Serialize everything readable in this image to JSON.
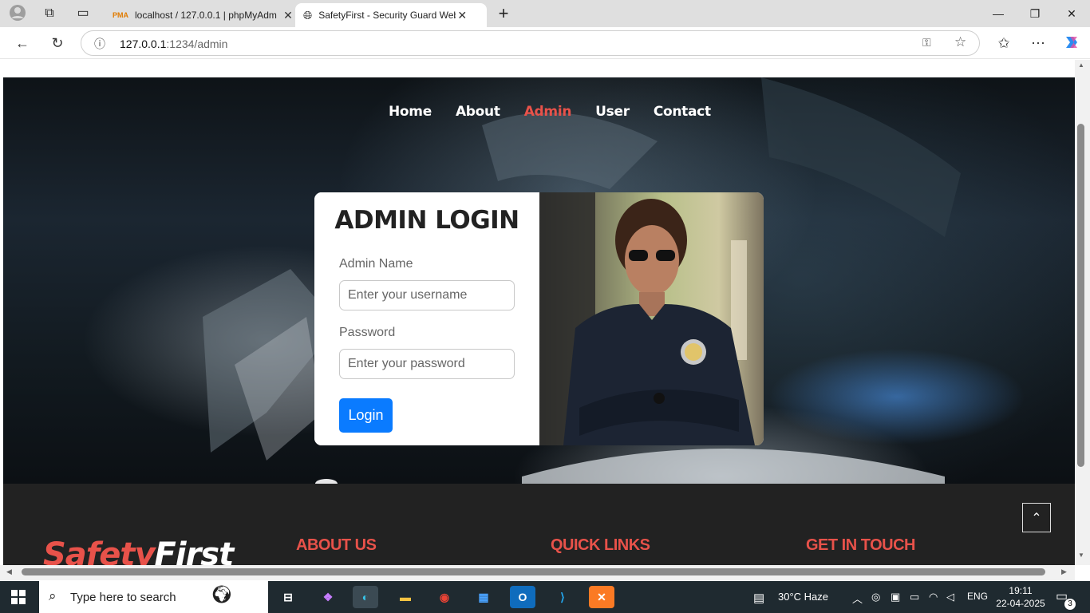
{
  "browser": {
    "tabs": [
      {
        "title": "localhost / 127.0.0.1 | phpMyAdm"
      },
      {
        "title": "SafetyFirst - Security Guard Websi"
      }
    ],
    "url_host": "127.0.0.1",
    "url_rest": ":1234/admin"
  },
  "site": {
    "nav": [
      "Home",
      "About",
      "Admin",
      "User",
      "Contact"
    ],
    "active_nav": "Admin",
    "login": {
      "title": "ADMIN LOGIN",
      "name_label": "Admin Name",
      "name_placeholder": "Enter your username",
      "password_label": "Password",
      "password_placeholder": "Enter your password",
      "button": "Login"
    },
    "footer": {
      "brand_part1": "Safety",
      "brand_part2": "First",
      "headings": [
        "ABOUT US",
        "QUICK LINKS",
        "GET IN TOUCH"
      ]
    },
    "colors": {
      "accent": "#e8524a",
      "button": "#0a7bff",
      "footer": "#222222"
    }
  },
  "taskbar": {
    "search_placeholder": "Type here to search",
    "weather": "30°C  Haze",
    "lang": "ENG",
    "time": "19:11",
    "date": "22-04-2025",
    "notifications": "3"
  }
}
